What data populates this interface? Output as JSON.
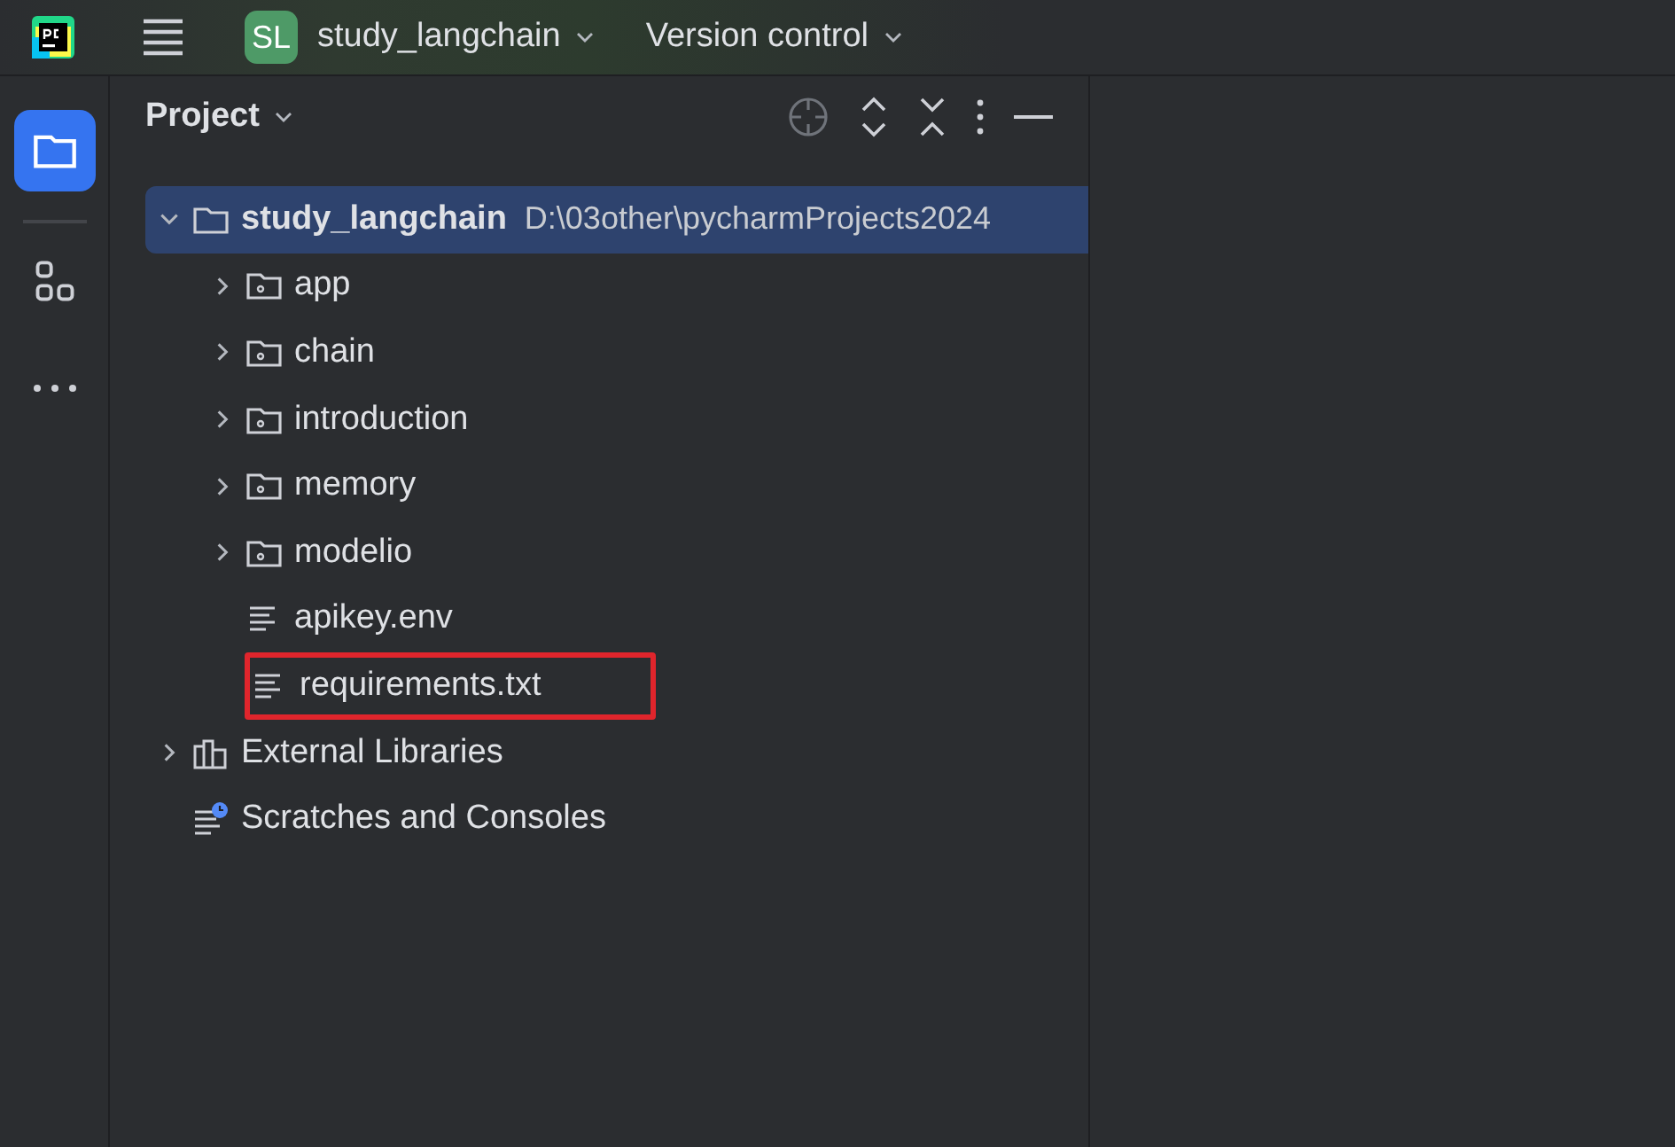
{
  "header": {
    "project_badge": "SL",
    "project_name": "study_langchain",
    "vcs": "Version control"
  },
  "left_toolbar": [
    {
      "kind": "project",
      "selected": true
    },
    {
      "kind": "structure",
      "selected": false
    },
    {
      "kind": "more",
      "selected": false
    }
  ],
  "panel": {
    "title": "Project"
  },
  "tree": [
    {
      "kind": "project",
      "name": "study_langchain",
      "path": "D:\\03other\\pycharmProjects2024",
      "expanded": true,
      "selected": true,
      "highlighted": false,
      "children": [
        {
          "kind": "folder",
          "name": "app",
          "expanded": false,
          "selected": false,
          "highlighted": false
        },
        {
          "kind": "folder",
          "name": "chain",
          "expanded": false,
          "selected": false,
          "highlighted": false
        },
        {
          "kind": "folder",
          "name": "introduction",
          "expanded": false,
          "selected": false,
          "highlighted": false
        },
        {
          "kind": "folder",
          "name": "memory",
          "expanded": false,
          "selected": false,
          "highlighted": false
        },
        {
          "kind": "folder",
          "name": "modelio",
          "expanded": false,
          "selected": false,
          "highlighted": false
        },
        {
          "kind": "file",
          "name": "apikey.env",
          "selected": false,
          "highlighted": false
        },
        {
          "kind": "file",
          "name": "requirements.txt",
          "selected": false,
          "highlighted": true
        }
      ]
    },
    {
      "kind": "library",
      "name": "External Libraries",
      "expanded": false,
      "selected": false,
      "highlighted": false
    },
    {
      "kind": "scratches",
      "name": "Scratches and Consoles",
      "selected": false,
      "highlighted": false
    }
  ]
}
